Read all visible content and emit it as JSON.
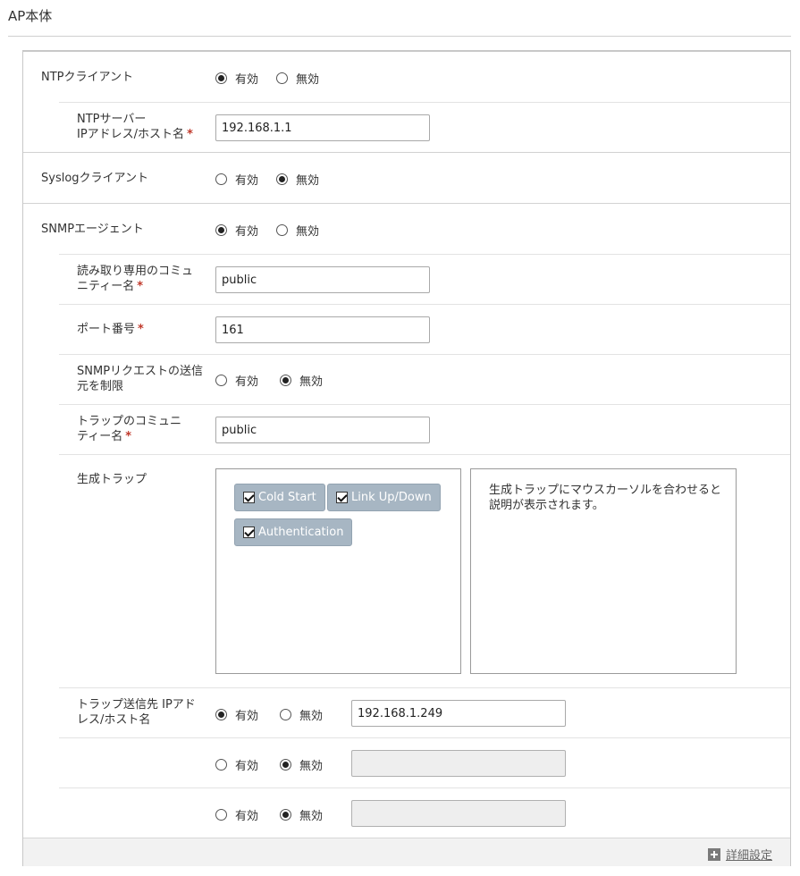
{
  "page": {
    "title": "AP本体"
  },
  "ntp": {
    "label": "NTPクライアント",
    "enable_label": "有効",
    "disable_label": "無効",
    "selected": "enable",
    "server_label_line1": "NTPサーバー",
    "server_label_line2": "IPアドレス/ホスト名",
    "server_value": "192.168.1.1"
  },
  "syslog": {
    "label": "Syslogクライアント",
    "enable_label": "有効",
    "disable_label": "無効",
    "selected": "disable"
  },
  "snmp": {
    "label": "SNMPエージェント",
    "enable_label": "有効",
    "disable_label": "無効",
    "selected": "enable",
    "ro_community_label_line1": "読み取り専用のコミュ",
    "ro_community_label_line2": "ニティー名",
    "ro_community_value": "public",
    "port_label": "ポート番号",
    "port_value": "161",
    "restrict_label_line1": "SNMPリクエストの送信",
    "restrict_label_line2": "元を制限",
    "restrict_enable_label": "有効",
    "restrict_disable_label": "無効",
    "restrict_selected": "disable",
    "trap_community_label_line1": "トラップのコミュニ",
    "trap_community_label_line2": "ティー名",
    "trap_community_value": "public",
    "traps_label": "生成トラップ",
    "traps": [
      {
        "label": "Cold Start",
        "checked": true
      },
      {
        "label": "Link Up/Down",
        "checked": true
      },
      {
        "label": "Authentication",
        "checked": true
      }
    ],
    "traps_description": "生成トラップにマウスカーソルを合わせると説明が表示されます。",
    "trap_dest_label_line1": "トラップ送信先 IPアド",
    "trap_dest_label_line2": "レス/ホスト名",
    "trap_destinations": [
      {
        "enable_label": "有効",
        "disable_label": "無効",
        "selected": "enable",
        "value": "192.168.1.249"
      },
      {
        "enable_label": "有効",
        "disable_label": "無効",
        "selected": "disable",
        "value": ""
      },
      {
        "enable_label": "有効",
        "disable_label": "無効",
        "selected": "disable",
        "value": ""
      }
    ]
  },
  "required_mark": "*",
  "footer": {
    "detail_link": "詳細設定",
    "icon": "plus-icon"
  }
}
